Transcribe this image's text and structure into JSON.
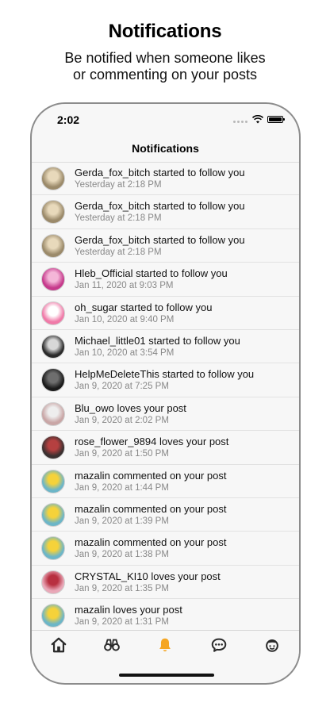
{
  "promo": {
    "title": "Notifications",
    "subtitle_line1": "Be notified when someone likes",
    "subtitle_line2": "or commenting on your posts"
  },
  "status_bar": {
    "time": "2:02"
  },
  "nav": {
    "title": "Notifications"
  },
  "notifications": [
    {
      "text": "Gerda_fox_bitch started to follow you",
      "time": "Yesterday at 2:18 PM",
      "avatar_color": "#9b8a6a",
      "avatar_accent": "#e8d9bb"
    },
    {
      "text": "Gerda_fox_bitch started to follow you",
      "time": "Yesterday at 2:18 PM",
      "avatar_color": "#9b8a6a",
      "avatar_accent": "#e8d9bb"
    },
    {
      "text": "Gerda_fox_bitch started to follow you",
      "time": "Yesterday at 2:18 PM",
      "avatar_color": "#9b8a6a",
      "avatar_accent": "#e8d9bb"
    },
    {
      "text": "Hleb_Official started to follow you",
      "time": "Jan 11, 2020 at 9:03 PM",
      "avatar_color": "#c63a8c",
      "avatar_accent": "#f4b6d8"
    },
    {
      "text": "oh_sugar started to follow you",
      "time": "Jan 10, 2020 at 9:40 PM",
      "avatar_color": "#f07aa8",
      "avatar_accent": "#ffffff"
    },
    {
      "text": "Michael_little01 started to follow you",
      "time": "Jan 10, 2020 at 3:54 PM",
      "avatar_color": "#2a2a2a",
      "avatar_accent": "#d8d8d8"
    },
    {
      "text": "HelpMeDeleteThis started to follow you",
      "time": "Jan 9, 2020 at 7:25 PM",
      "avatar_color": "#1b1b1b",
      "avatar_accent": "#6e6e6e"
    },
    {
      "text": "Blu_owo loves your post",
      "time": "Jan 9, 2020 at 2:02 PM",
      "avatar_color": "#c9a6a6",
      "avatar_accent": "#eeeeee"
    },
    {
      "text": "rose_flower_9894 loves your post",
      "time": "Jan 9, 2020 at 1:50 PM",
      "avatar_color": "#3a3030",
      "avatar_accent": "#b54040"
    },
    {
      "text": "mazalin commented on your post",
      "time": "Jan 9, 2020 at 1:44 PM",
      "avatar_color": "#6cb6c8",
      "avatar_accent": "#f5d23a"
    },
    {
      "text": "mazalin commented on your post",
      "time": "Jan 9, 2020 at 1:39 PM",
      "avatar_color": "#6cb6c8",
      "avatar_accent": "#f5d23a"
    },
    {
      "text": "mazalin commented on your post",
      "time": "Jan 9, 2020 at 1:38 PM",
      "avatar_color": "#6cb6c8",
      "avatar_accent": "#f5d23a"
    },
    {
      "text": "CRYSTAL_KI10 loves your post",
      "time": "Jan 9, 2020 at 1:35 PM",
      "avatar_color": "#e9a8b8",
      "avatar_accent": "#b83040"
    },
    {
      "text": "mazalin loves your post",
      "time": "Jan 9, 2020 at 1:31 PM",
      "avatar_color": "#6cb6c8",
      "avatar_accent": "#f5d23a"
    }
  ],
  "tab_bar": {
    "active_color": "#f5a623",
    "inactive_color": "#2a2a2a",
    "tabs": [
      {
        "icon": "home-icon",
        "active": false
      },
      {
        "icon": "binoculars-icon",
        "active": false
      },
      {
        "icon": "bell-icon",
        "active": true
      },
      {
        "icon": "chat-bubble-icon",
        "active": false
      },
      {
        "icon": "profile-face-icon",
        "active": false
      }
    ]
  }
}
